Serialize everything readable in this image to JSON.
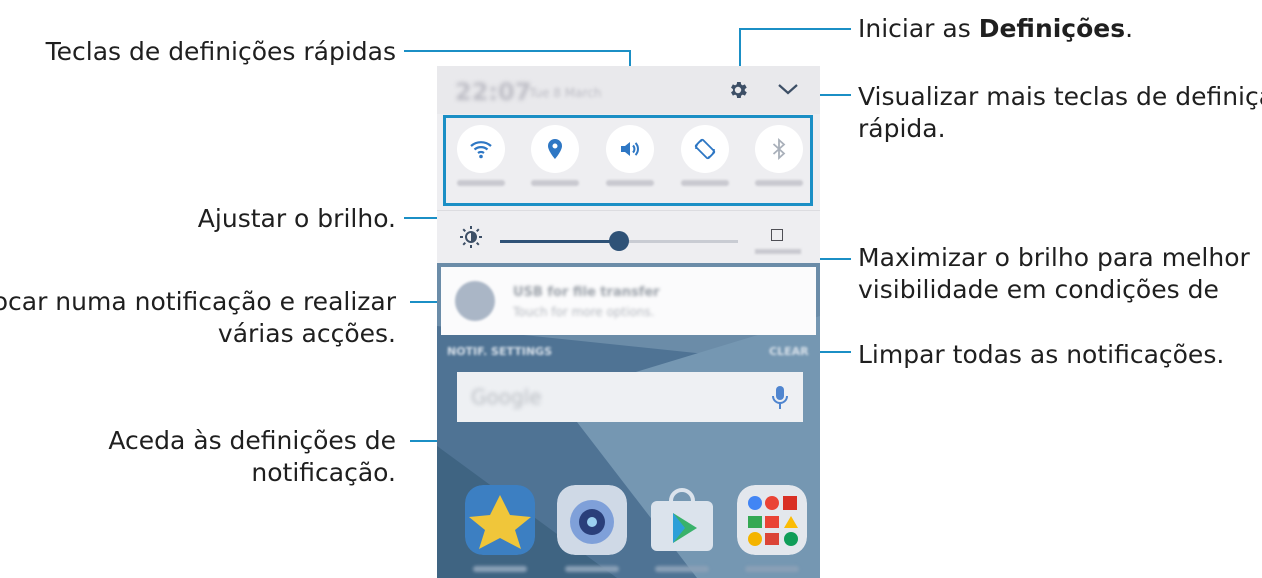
{
  "callouts": {
    "quick_settings": "Teclas de definições rápidas",
    "brightness": "Ajustar o brilho.",
    "notification_line1": "Tocar numa notificação e realizar",
    "notification_line2": "várias acções.",
    "notif_settings_line1": "Aceda às definições de",
    "notif_settings_line2": "notificação.",
    "settings_prefix": "Iniciar as ",
    "settings_bold": "Definições",
    "settings_suffix": ".",
    "more_quick_line1": "Visualizar mais teclas de definição",
    "more_quick_line2": "rápida.",
    "max_bright_line1": "Maximizar o brilho para melhor",
    "max_bright_line2": "visibilidade em condições de",
    "clear_all": "Limpar todas as notificações."
  },
  "phone": {
    "quick_toggles": [
      {
        "icon": "wifi-icon"
      },
      {
        "icon": "location-icon"
      },
      {
        "icon": "sound-icon"
      },
      {
        "icon": "auto-rotate-icon"
      },
      {
        "icon": "bluetooth-icon"
      }
    ],
    "brightness_level": 0.5,
    "search_icon": "mic-icon",
    "apps": [
      {
        "icon": "gallery-app-icon"
      },
      {
        "icon": "camera-app-icon"
      },
      {
        "icon": "play-store-app-icon"
      },
      {
        "icon": "google-folder-icon"
      }
    ]
  },
  "colors": {
    "accent": "#1b8fc5",
    "slider": "#2f5277",
    "wallpaper": "#5e7f9b"
  }
}
